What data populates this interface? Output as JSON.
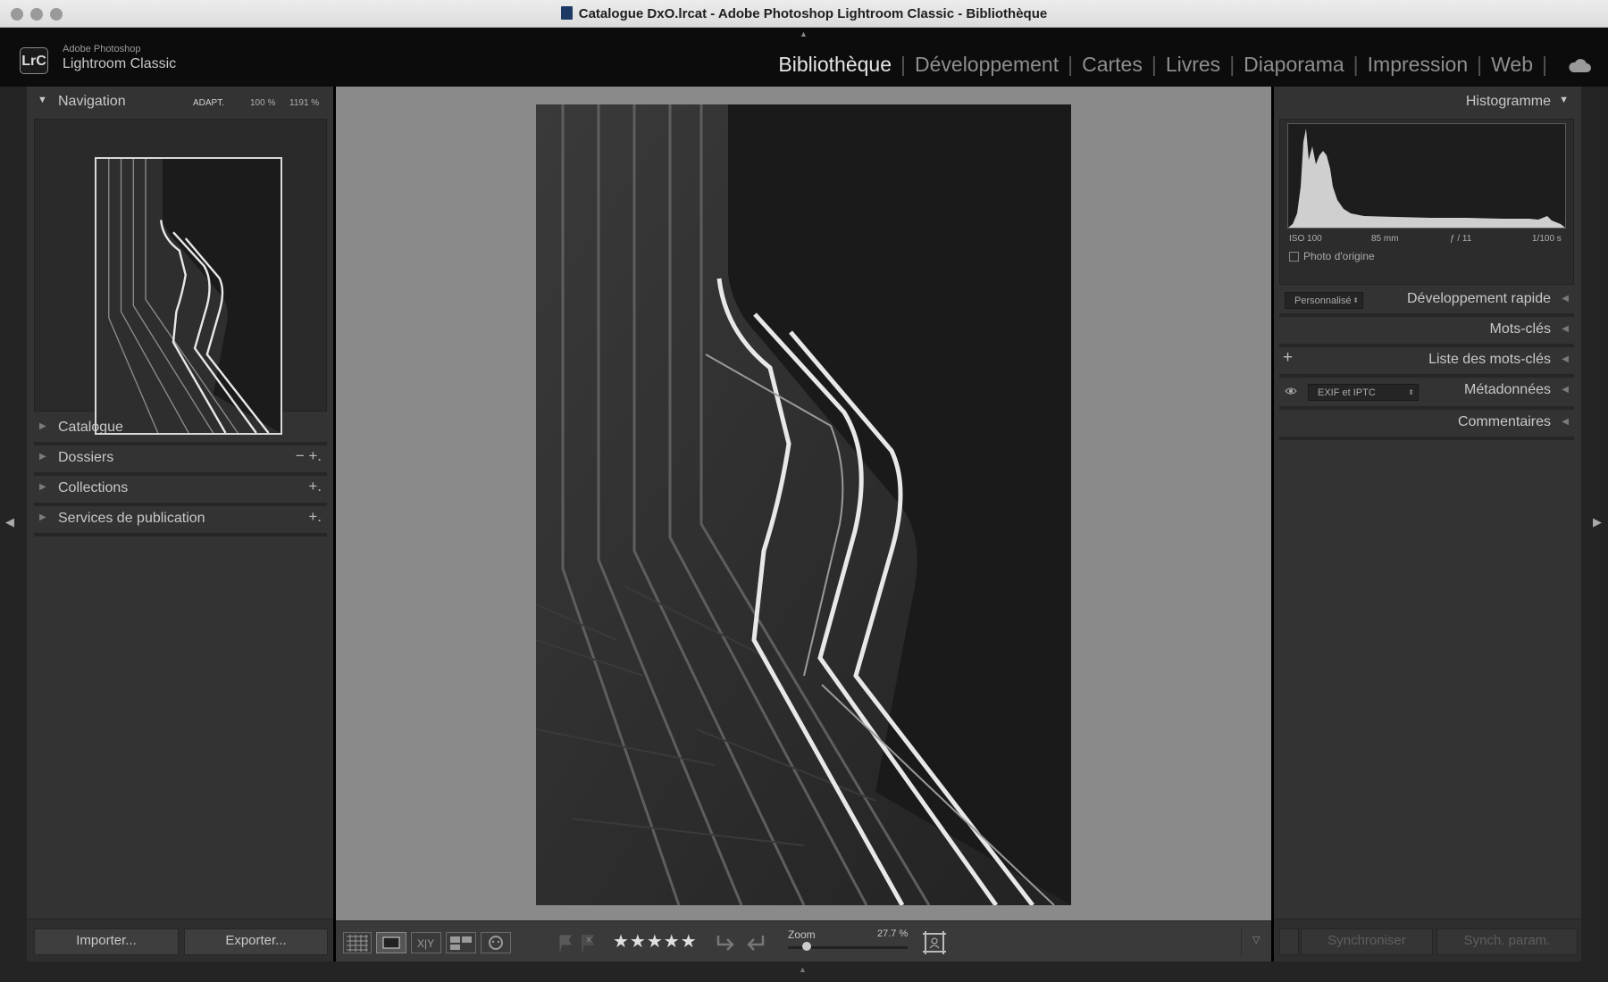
{
  "window": {
    "title": "Catalogue DxO.lrcat - Adobe Photoshop Lightroom Classic - Bibliothèque"
  },
  "identity": {
    "brand_top": "Adobe Photoshop",
    "brand_main": "Lightroom Classic",
    "logo": "LrC"
  },
  "modules": [
    "Bibliothèque",
    "Développement",
    "Cartes",
    "Livres",
    "Diaporama",
    "Impression",
    "Web"
  ],
  "active_module": "Bibliothèque",
  "left": {
    "navigation": {
      "title": "Navigation",
      "fit": "ADAPT.",
      "zoom1": "100 %",
      "zoom2": "1191 %"
    },
    "sections": [
      {
        "label": "Catalogue",
        "actions": ""
      },
      {
        "label": "Dossiers",
        "actions": "−  +."
      },
      {
        "label": "Collections",
        "actions": "+."
      },
      {
        "label": "Services de publication",
        "actions": "+."
      }
    ],
    "import_label": "Importer...",
    "export_label": "Exporter..."
  },
  "right": {
    "histogram": {
      "title": "Histogramme",
      "iso": "ISO 100",
      "focal": "85 mm",
      "aperture": "ƒ / 11",
      "shutter": "1/100 s",
      "original_label": "Photo d'origine"
    },
    "quick_develop": {
      "preset": "Personnalisé",
      "title": "Développement rapide"
    },
    "keywording": {
      "title": "Mots-clés"
    },
    "keyword_list": {
      "title": "Liste des mots-clés"
    },
    "metadata": {
      "preset": "EXIF et IPTC",
      "title": "Métadonnées"
    },
    "comments": {
      "title": "Commentaires"
    },
    "sync_label": "Synchroniser",
    "sync_settings_label": "Synch. param."
  },
  "toolbar": {
    "rating": "★★★★★",
    "zoom_label": "Zoom",
    "zoom_value": "27.7 %"
  },
  "colors": {
    "panel": "#333333",
    "background": "#8a8a8a",
    "active_text": "#e6e6e6"
  }
}
